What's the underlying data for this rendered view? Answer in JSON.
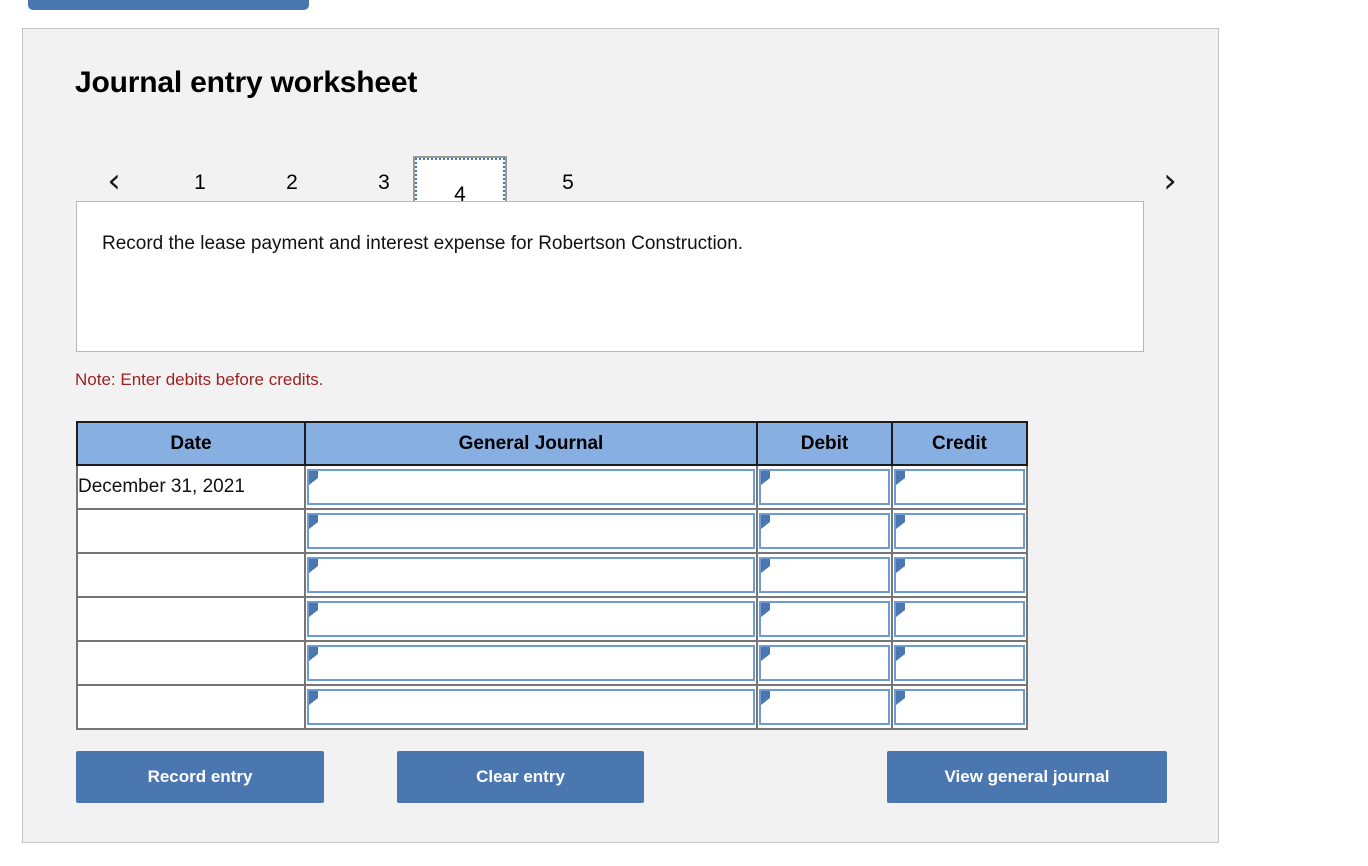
{
  "top_cut_button": {
    "label": ""
  },
  "panel": {
    "title": "Journal entry worksheet"
  },
  "pager": {
    "prev_icon": "chevron-left-icon",
    "next_icon": "chevron-right-icon",
    "prev_glyph": "‹",
    "next_glyph": "›",
    "tabs": [
      {
        "label": "1",
        "active": false
      },
      {
        "label": "2",
        "active": false
      },
      {
        "label": "3",
        "active": false
      },
      {
        "label": "4",
        "active": true
      },
      {
        "label": "5",
        "active": false
      }
    ],
    "active_tab": "4"
  },
  "description": {
    "text": "Record the lease payment and interest expense for Robertson Construction."
  },
  "note": {
    "text": "Note: Enter debits before credits."
  },
  "table": {
    "columns": [
      "Date",
      "General Journal",
      "Debit",
      "Credit"
    ],
    "rows": [
      {
        "date": "December 31, 2021",
        "general_journal": "",
        "debit": "",
        "credit": ""
      },
      {
        "date": "",
        "general_journal": "",
        "debit": "",
        "credit": ""
      },
      {
        "date": "",
        "general_journal": "",
        "debit": "",
        "credit": ""
      },
      {
        "date": "",
        "general_journal": "",
        "debit": "",
        "credit": ""
      },
      {
        "date": "",
        "general_journal": "",
        "debit": "",
        "credit": ""
      },
      {
        "date": "",
        "general_journal": "",
        "debit": "",
        "credit": ""
      }
    ]
  },
  "buttons": {
    "record": "Record entry",
    "clear": "Clear entry",
    "view": "View general journal"
  },
  "colors": {
    "accent_blue": "#4a77b0",
    "header_blue": "#87afe2",
    "note_red": "#9c2222",
    "panel_bg": "#f2f2f2",
    "panel_border": "#c3c3c3"
  }
}
